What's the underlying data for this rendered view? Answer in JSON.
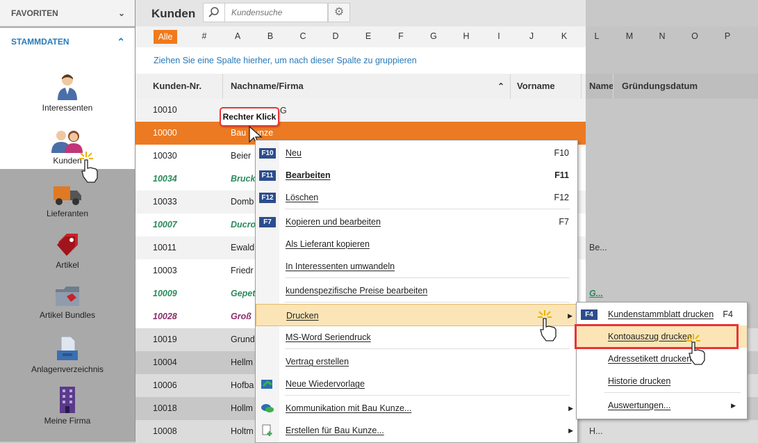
{
  "sidebar": {
    "favoriten": "FAVORITEN",
    "stammdaten": "STAMMDATEN",
    "items": [
      {
        "label": "Interessenten"
      },
      {
        "label": "Kunden"
      },
      {
        "label": "Lieferanten"
      },
      {
        "label": "Artikel"
      },
      {
        "label": "Artikel Bundles"
      },
      {
        "label": "Anlagenverzeichnis"
      },
      {
        "label": "Meine Firma"
      }
    ]
  },
  "header": {
    "title": "Kunden",
    "search_placeholder": "Kundensuche"
  },
  "letters": [
    "Alle",
    "#",
    "A",
    "B",
    "C",
    "D",
    "E",
    "F",
    "G",
    "H",
    "I",
    "J",
    "K",
    "L",
    "M",
    "N",
    "O",
    "P"
  ],
  "group_hint": "Ziehen Sie eine Spalte hierher, um nach dieser Spalte zu gruppieren",
  "columns": [
    "Kunden-Nr.",
    "Nachname/Firma",
    "Vorname",
    "Name",
    "Gründungsdatum"
  ],
  "rows": [
    {
      "nr": "10010",
      "name": "",
      "extra": ""
    },
    {
      "nr": "10000",
      "name": "Bau Kunze",
      "extra": ""
    },
    {
      "nr": "10030",
      "name": "Beier",
      "extra": ""
    },
    {
      "nr": "10034",
      "name": "Bruck",
      "extra": ""
    },
    {
      "nr": "10033",
      "name": "Domb",
      "extra": ""
    },
    {
      "nr": "10007",
      "name": "Ducro",
      "extra": ""
    },
    {
      "nr": "10011",
      "name": "Ewald",
      "extra": "Be..."
    },
    {
      "nr": "10003",
      "name": "Friedr",
      "extra": ""
    },
    {
      "nr": "10009",
      "name": "Gepet",
      "extra": "G..."
    },
    {
      "nr": "10028",
      "name": "Groß",
      "extra": ""
    },
    {
      "nr": "10019",
      "name": "Grund",
      "extra": ""
    },
    {
      "nr": "10004",
      "name": "Hellm",
      "extra": ""
    },
    {
      "nr": "10006",
      "name": "Hofba",
      "extra": ""
    },
    {
      "nr": "10018",
      "name": "Hollm",
      "extra": ""
    },
    {
      "nr": "10008",
      "name": "Holtm",
      "extra": "H..."
    }
  ],
  "ghost_letter": "G",
  "callout": "Rechter Klick",
  "context_menu": {
    "items": [
      {
        "key": "F10",
        "label": "Neu",
        "shortcut": "F10"
      },
      {
        "key": "F11",
        "label": "Bearbeiten",
        "shortcut": "F11"
      },
      {
        "key": "F12",
        "label": "Löschen",
        "shortcut": "F12"
      },
      {
        "key": "F7",
        "label": "Kopieren und bearbeiten",
        "shortcut": "F7"
      },
      {
        "label": "Als Lieferant kopieren"
      },
      {
        "label": "In Interessenten umwandeln"
      },
      {
        "label": "kundenspezifische Preise bearbeiten"
      },
      {
        "label": "Drucken"
      },
      {
        "label": "MS-Word Seriendruck"
      },
      {
        "label": "Vertrag erstellen"
      },
      {
        "label": "Neue Wiedervorlage"
      },
      {
        "label": "Kommunikation mit Bau Kunze..."
      },
      {
        "label": "Erstellen für Bau Kunze..."
      }
    ]
  },
  "submenu": {
    "items": [
      {
        "key": "F4",
        "label": "Kundenstammblatt drucken",
        "shortcut": "F4"
      },
      {
        "label": "Kontoauszug drucken"
      },
      {
        "label": "Adressetikett drucken"
      },
      {
        "label": "Historie drucken"
      },
      {
        "label": "Auswertungen..."
      }
    ]
  },
  "colors": {
    "accent": "#ec7a22",
    "link": "#2a7ab8",
    "key_badge": "#2c4d8c",
    "highlight": "#fbe5b6",
    "red_box": "#e8333a"
  }
}
